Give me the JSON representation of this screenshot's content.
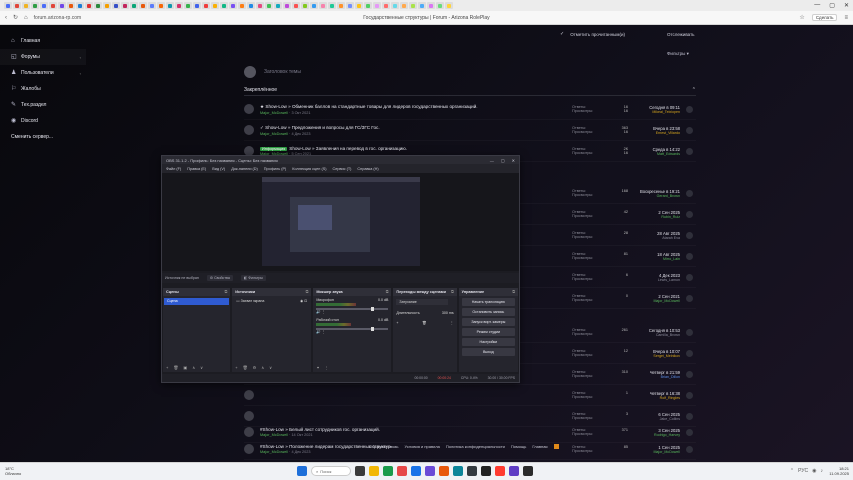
{
  "browser": {
    "tab_colors": [
      "#4a6cf7",
      "#e0453a",
      "#f0b323",
      "#2f9e44",
      "#4a6cf7",
      "#e0453a",
      "#7048e8",
      "#e8590c",
      "#1c7ed6",
      "#e03131",
      "#2b8a3e",
      "#f59f00",
      "#364fc7",
      "#c2255c",
      "#0ca678",
      "#e8590c",
      "#5c7cfa",
      "#f76707",
      "#1098ad",
      "#d6336c",
      "#37b24d",
      "#4263eb",
      "#f03e3e",
      "#fab005",
      "#12b886",
      "#7950f2",
      "#fd7e14",
      "#228be6",
      "#e64980",
      "#40c057",
      "#15aabf",
      "#be4bdb",
      "#fa5252",
      "#82c91e",
      "#339af0",
      "#f783ac",
      "#20c997",
      "#ff922b",
      "#748ffc",
      "#fcc419",
      "#51cf66",
      "#e599f7",
      "#ff6b6b",
      "#66d9e8",
      "#ffa94d",
      "#a9e34b",
      "#4dabf7",
      "#da77f2",
      "#69db7c",
      "#ffd43b"
    ],
    "url": "forum.arizona-rp.com",
    "page_title": "Государственные структуры | Forum - Arizona RolePlay",
    "profile_button": "Сделать",
    "controls": [
      "—",
      "▢",
      "✕"
    ]
  },
  "sidebar": {
    "items": [
      {
        "label": "Главная",
        "icon": "⌂",
        "icon_name": "home-icon"
      },
      {
        "label": "Форумы",
        "icon": "◱",
        "icon_name": "forums-icon",
        "chevron": "‹"
      },
      {
        "label": "Пользователи",
        "icon": "♟",
        "icon_name": "users-icon",
        "chevron": "‹"
      },
      {
        "label": "Жалобы",
        "icon": "⚐",
        "icon_name": "complaints-icon"
      },
      {
        "label": "Тех.раздел",
        "icon": "✎",
        "icon_name": "tech-icon"
      },
      {
        "label": "Discord",
        "icon": "◉",
        "icon_name": "discord-icon"
      },
      {
        "label": "Сменить сервер...",
        "icon": "",
        "icon_name": ""
      }
    ]
  },
  "topnav": {
    "mark_read": "Отметить прочитанным(и)",
    "subscribe": "Отслеживать",
    "filters": "Фильтры ▾"
  },
  "section": {
    "create_placeholder": "Заголовок темы",
    "pinned": "Закреплённое",
    "collapse": "⌃"
  },
  "threads": [
    {
      "title": "★ Show-Low » Обменник баллов на стандартные товары для лидеров государственных организаций.",
      "author": "Major_McDowell",
      "date": "3 Окт 2021",
      "replies": "16",
      "views": "16",
      "latest_date": "Сегодня в 09:11",
      "latest_who": "Mikeal_Teixiopen",
      "who_color": "y",
      "prefix": "",
      "prefix_color": ""
    },
    {
      "title": "✓ Show-Low » Предложения и вопросы для ГС/ЗГС Гос.",
      "author": "Major_McDowell",
      "date": "4 Дек 2023",
      "replies": "363",
      "views": "16",
      "latest_date": "Вчера в 23:58",
      "latest_who": "Ernest_Villardo",
      "who_color": "y",
      "prefix": "",
      "prefix_color": ""
    },
    {
      "title": "Show-Low » Заявления на перевод в гос. организацию.",
      "author": "Major_McDowell",
      "date": "5 Сен 2021",
      "replies": "2К",
      "views": "16",
      "latest_date": "Среда в 14:22",
      "latest_who": "Matt_Edwards",
      "who_color": "g",
      "prefix": "Информация",
      "prefix_color": "#2f9e44"
    },
    {
      "title": "",
      "author": "",
      "date": "",
      "replies": "168",
      "views": "",
      "latest_date": "Воскресенье в 19:21",
      "latest_who": "Gerard_Brown",
      "who_color": "g",
      "prefix": "",
      "prefix_color": ""
    },
    {
      "title": "",
      "author": "",
      "date": "",
      "replies": "42",
      "views": "",
      "latest_date": "2 Сен 2025",
      "latest_who": "Rubin_Ruiz",
      "who_color": "g",
      "prefix": "",
      "prefix_color": ""
    },
    {
      "title": "",
      "author": "",
      "date": "",
      "replies": "28",
      "views": "",
      "latest_date": "28 Авг 2025",
      "latest_who": "Atarah Eva",
      "who_color": "",
      "prefix": "",
      "prefix_color": ""
    },
    {
      "title": "",
      "author": "",
      "date": "",
      "replies": "81",
      "views": "",
      "latest_date": "18 Авг 2025",
      "latest_who": "Mirro_Lain",
      "who_color": "g",
      "prefix": "",
      "prefix_color": ""
    },
    {
      "title": "",
      "author": "",
      "date": "",
      "replies": "6",
      "views": "",
      "latest_date": "4 Дек 2023",
      "latest_who": "Lewis_Lamon",
      "who_color": "",
      "prefix": "",
      "prefix_color": ""
    },
    {
      "title": "",
      "author": "",
      "date": "",
      "replies": "0",
      "views": "",
      "latest_date": "2 Сен 2021",
      "latest_who": "Major_McDowell",
      "who_color": "g",
      "prefix": "",
      "prefix_color": ""
    },
    {
      "title": "",
      "author": "",
      "date": "",
      "replies": "261",
      "views": "",
      "latest_date": "Сегодня в 10:53",
      "latest_who": "Camilla_Brown",
      "who_color": "",
      "prefix": "",
      "prefix_color": ""
    },
    {
      "title": "",
      "author": "",
      "date": "",
      "replies": "12",
      "views": "",
      "latest_date": "Вчера в 10:07",
      "latest_who": "Sergei_Melnikov",
      "who_color": "y",
      "prefix": "",
      "prefix_color": ""
    },
    {
      "title": "",
      "author": "",
      "date": "",
      "replies": "310",
      "views": "",
      "latest_date": "Четверг в 21:59",
      "latest_who": "Brian_Dillon",
      "who_color": "b",
      "prefix": "",
      "prefix_color": ""
    },
    {
      "title": "",
      "author": "",
      "date": "",
      "replies": "1",
      "views": "",
      "latest_date": "Четверг в 16:38",
      "latest_who": "Rolf_Ringles",
      "who_color": "y",
      "prefix": "",
      "prefix_color": ""
    },
    {
      "title": "",
      "author": "",
      "date": "",
      "replies": "3",
      "views": "",
      "latest_date": "6 Сен 2025",
      "latest_who": "Jake_Collins",
      "who_color": "",
      "prefix": "",
      "prefix_color": ""
    },
    {
      "title": "#Show-Low » Белый лист сотрудников гос. организаций.",
      "author": "Major_McDowell",
      "date": "14 Окт 2021",
      "replies": "371",
      "views": "",
      "latest_date": "3 Сен 2025",
      "latest_who": "Rodrigo_Harvey",
      "who_color": "g",
      "prefix": "",
      "prefix_color": ""
    },
    {
      "title": "#Show-Low » Положение лидерам государственных структур.",
      "author": "Major_McDowell",
      "date": "4 Дек 2023",
      "replies": "85",
      "views": "",
      "latest_date": "1 Сен 2025",
      "latest_who": "Major_McDowell",
      "who_color": "g",
      "prefix": "",
      "prefix_color": ""
    }
  ],
  "stats_labels": {
    "replies": "Ответы:",
    "views": "Просмотры:"
  },
  "footer": {
    "links": [
      "Обратная связь",
      "Условия и правила",
      "Политика конфиденциальности",
      "Помощь",
      "Главная"
    ]
  },
  "obs": {
    "title": "OBS 31.1.2 - Профиль: Без названия - Сцены: Без названия",
    "menu": [
      "Файл (F)",
      "Правка (E)",
      "Вид (V)",
      "Док-панели (D)",
      "Профиль (P)",
      "Коллекция сцен (S)",
      "Сервис (T)",
      "Справка (H)"
    ],
    "source_bar": {
      "status": "Источник не выбран",
      "properties": "⚙ Свойства",
      "filters": "◧ Фильтры"
    },
    "docks": {
      "scenes": {
        "title": "Сцены",
        "items": [
          "Сцена"
        ]
      },
      "sources": {
        "title": "Источники",
        "items": [
          "Захват экрана"
        ]
      },
      "mixer": {
        "title": "Микшер звука",
        "channels": [
          {
            "name": "Микрофон",
            "db": "0.0 dB",
            "level": 0.55
          },
          {
            "name": "Рабочий стол",
            "db": "0.0 dB",
            "level": 0.48
          }
        ]
      },
      "transitions": {
        "title": "Переходы между сценами",
        "type": "Затухание",
        "duration_label": "Длительность",
        "duration": "300 ms"
      },
      "controls": {
        "title": "Управление",
        "buttons": [
          "Начать трансляцию",
          "Остановить запись",
          "Запуск вирт. камеры",
          "Режим студии",
          "Настройки",
          "Выход"
        ]
      }
    },
    "status": {
      "rec_time": "00:00:24",
      "cpu": "CPU: 0.4%",
      "fps": "30.00 / 30.00 FPS",
      "live": "00:00:00"
    }
  },
  "taskbar": {
    "weather_temp": "18°C",
    "weather_desc": "Облачно",
    "search_label": "Поиск",
    "app_colors": [
      "#1e6fd9",
      "#3a3a3a",
      "#f2b705",
      "#1b9b4b",
      "#e64848",
      "#1a73e8",
      "#6b4bd6",
      "#e8590c",
      "#0c8599",
      "#343a40",
      "#222222",
      "#ff3b30",
      "#5f3dc4",
      "#2b2b2b"
    ],
    "tray_icons": [
      "⌃",
      "РУС",
      "◉",
      "♪"
    ],
    "time": "18:21",
    "date": "11.09.2025"
  }
}
